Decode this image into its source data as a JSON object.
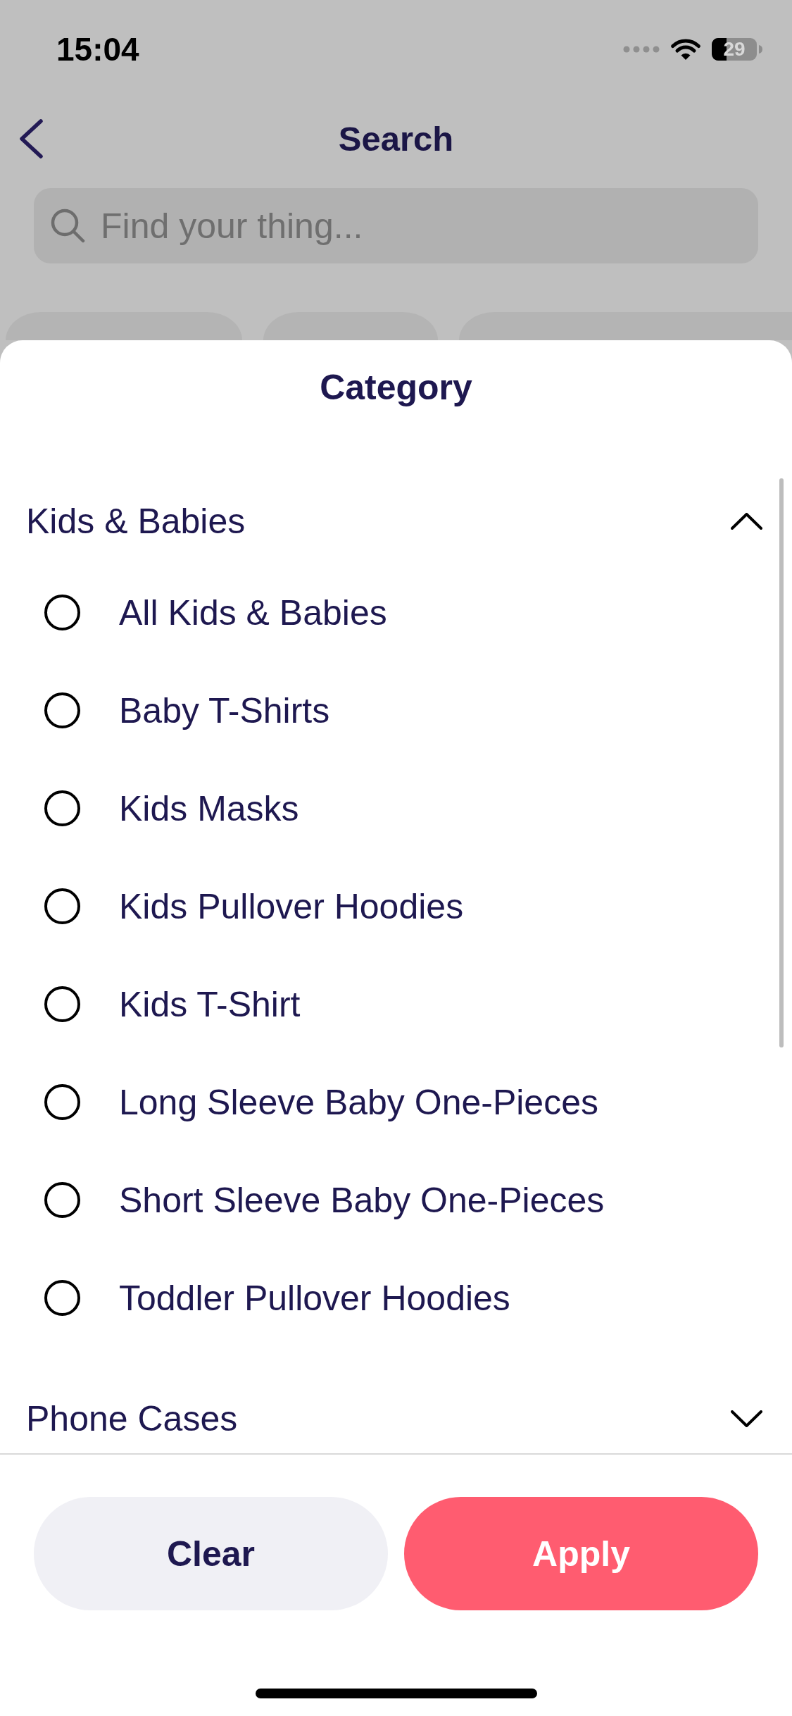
{
  "status_bar": {
    "time": "15:04",
    "battery": "29"
  },
  "header": {
    "title": "Search"
  },
  "search": {
    "placeholder": "Find your thing..."
  },
  "sheet": {
    "title": "Category",
    "groups": [
      {
        "label": "Kids & Babies",
        "expanded": true,
        "options": [
          {
            "label": "All Kids & Babies",
            "selected": false
          },
          {
            "label": "Baby T-Shirts",
            "selected": false
          },
          {
            "label": "Kids Masks",
            "selected": false
          },
          {
            "label": "Kids Pullover Hoodies",
            "selected": false
          },
          {
            "label": "Kids T-Shirt",
            "selected": false
          },
          {
            "label": "Long Sleeve Baby One-Pieces",
            "selected": false
          },
          {
            "label": "Short Sleeve Baby One-Pieces",
            "selected": false
          },
          {
            "label": "Toddler Pullover Hoodies",
            "selected": false
          }
        ]
      },
      {
        "label": "Phone Cases",
        "expanded": false
      }
    ]
  },
  "buttons": [
    {
      "label": "Clear",
      "kind": "secondary"
    },
    {
      "label": "Apply",
      "kind": "primary"
    }
  ]
}
